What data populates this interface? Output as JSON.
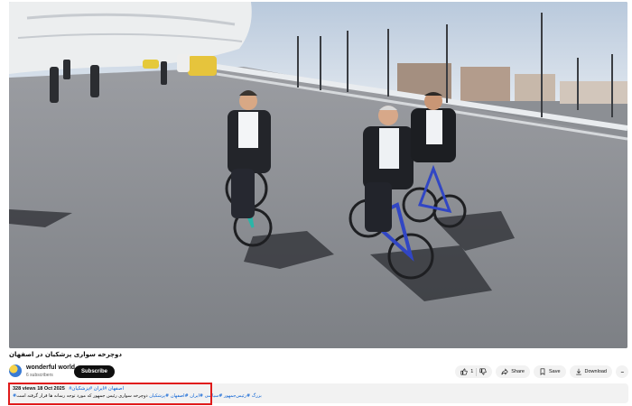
{
  "video": {
    "title": "دوچرخه سواری پزشکیان در اصفهان"
  },
  "channel": {
    "name": "wonderful world",
    "subscribers": "6 subscribers",
    "subscribe_label": "Subscribe"
  },
  "actions": {
    "likes": "1",
    "share_label": "Share",
    "save_label": "Save",
    "download_label": "Download",
    "more_label": "..."
  },
  "description": {
    "views": "328 views",
    "date": "18 Oct 2025",
    "tags": "#اصفهان #ایران #پزشکیان",
    "line_tags": "#بزرگ #رئیس‌جمهور #سیاسی #ایران #اصفهان #پزشکیان",
    "line_text": "دوچرخه سواری رئیس جمهور که مورد توجه رسانه ها قرار گرفته است"
  },
  "colors": {
    "highlight": "#e01b1b",
    "link": "#065fd4",
    "subscribe_bg": "#0f0f0f"
  }
}
